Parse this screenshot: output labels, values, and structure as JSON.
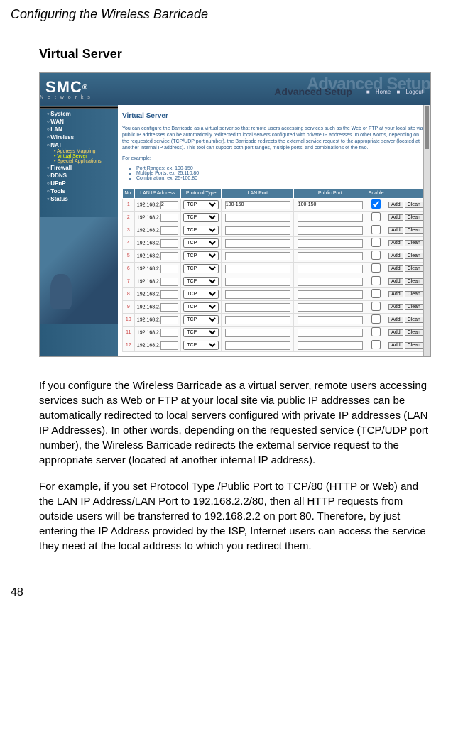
{
  "doc_header": "Configuring the Wireless Barricade",
  "section_title": "Virtual Server",
  "page_number": "48",
  "app": {
    "logo": "SMC",
    "logo_sub": "N e t w o r k s",
    "banner_ghost": "Advanced Setup",
    "banner_label": "Advanced Setup",
    "home": "Home",
    "logout": "Logout"
  },
  "sidebar": {
    "items": [
      "System",
      "WAN",
      "LAN",
      "Wireless",
      "NAT",
      "Firewall",
      "DDNS",
      "UPnP",
      "Tools",
      "Status"
    ],
    "subitems": [
      "Address Mapping",
      "Virtual Server",
      "Special Applications"
    ]
  },
  "panel": {
    "title": "Virtual Server",
    "desc1": "You can configure the Barricade as a virtual server so that remote users accessing services such as the Web or FTP at your local site via public IP addresses can be automatically redirected to local servers configured with private IP addresses. In other words, depending on the requested service (TCP/UDP port number), the Barricade redirects the external service request to the appropriate server (located at another internal IP address). This tool can support both port ranges, multiple ports, and combinations of the two.",
    "example_label": "For example:",
    "examples": [
      "Port Ranges: ex. 100-150",
      "Multiple Ports: ex. 25,110,80",
      "Combination: ex. 25-100,80"
    ],
    "headers": {
      "no": "No.",
      "ip": "LAN IP Address",
      "proto": "Protocol Type",
      "lanport": "LAN Port",
      "pubport": "Public Port",
      "enable": "Enable"
    },
    "ip_prefix": "192.168.2.",
    "proto_opt": "TCP",
    "add_btn": "Add",
    "clean_btn": "Clean",
    "rows": [
      {
        "n": "1",
        "ip": "2",
        "lan": "100-150",
        "pub": "100-150",
        "en": true
      },
      {
        "n": "2",
        "ip": "",
        "lan": "",
        "pub": "",
        "en": false
      },
      {
        "n": "3",
        "ip": "",
        "lan": "",
        "pub": "",
        "en": false
      },
      {
        "n": "4",
        "ip": "",
        "lan": "",
        "pub": "",
        "en": false
      },
      {
        "n": "5",
        "ip": "",
        "lan": "",
        "pub": "",
        "en": false
      },
      {
        "n": "6",
        "ip": "",
        "lan": "",
        "pub": "",
        "en": false
      },
      {
        "n": "7",
        "ip": "",
        "lan": "",
        "pub": "",
        "en": false
      },
      {
        "n": "8",
        "ip": "",
        "lan": "",
        "pub": "",
        "en": false
      },
      {
        "n": "9",
        "ip": "",
        "lan": "",
        "pub": "",
        "en": false
      },
      {
        "n": "10",
        "ip": "",
        "lan": "",
        "pub": "",
        "en": false
      },
      {
        "n": "11",
        "ip": "",
        "lan": "",
        "pub": "",
        "en": false
      },
      {
        "n": "12",
        "ip": "",
        "lan": "",
        "pub": "",
        "en": false
      }
    ]
  },
  "body": {
    "p1": "If you configure the Wireless Barricade as a virtual server, remote users accessing services such as Web or FTP at your local site via public IP addresses can be automatically redirected to local servers configured with private IP addresses (LAN IP Addresses). In other words, depending on the requested service (TCP/UDP port number), the Wireless Barricade redirects the external service request to the appropriate server (located at another internal IP address).",
    "p2": "For example, if you set Protocol Type /Public Port to TCP/80 (HTTP or Web) and the LAN IP Address/LAN Port to 192.168.2.2/80, then all HTTP requests from outside users will be transferred to 192.168.2.2 on port 80. Therefore, by just entering the IP Address provided by the ISP, Internet users can access the service they need at the local address to which you redirect them."
  }
}
